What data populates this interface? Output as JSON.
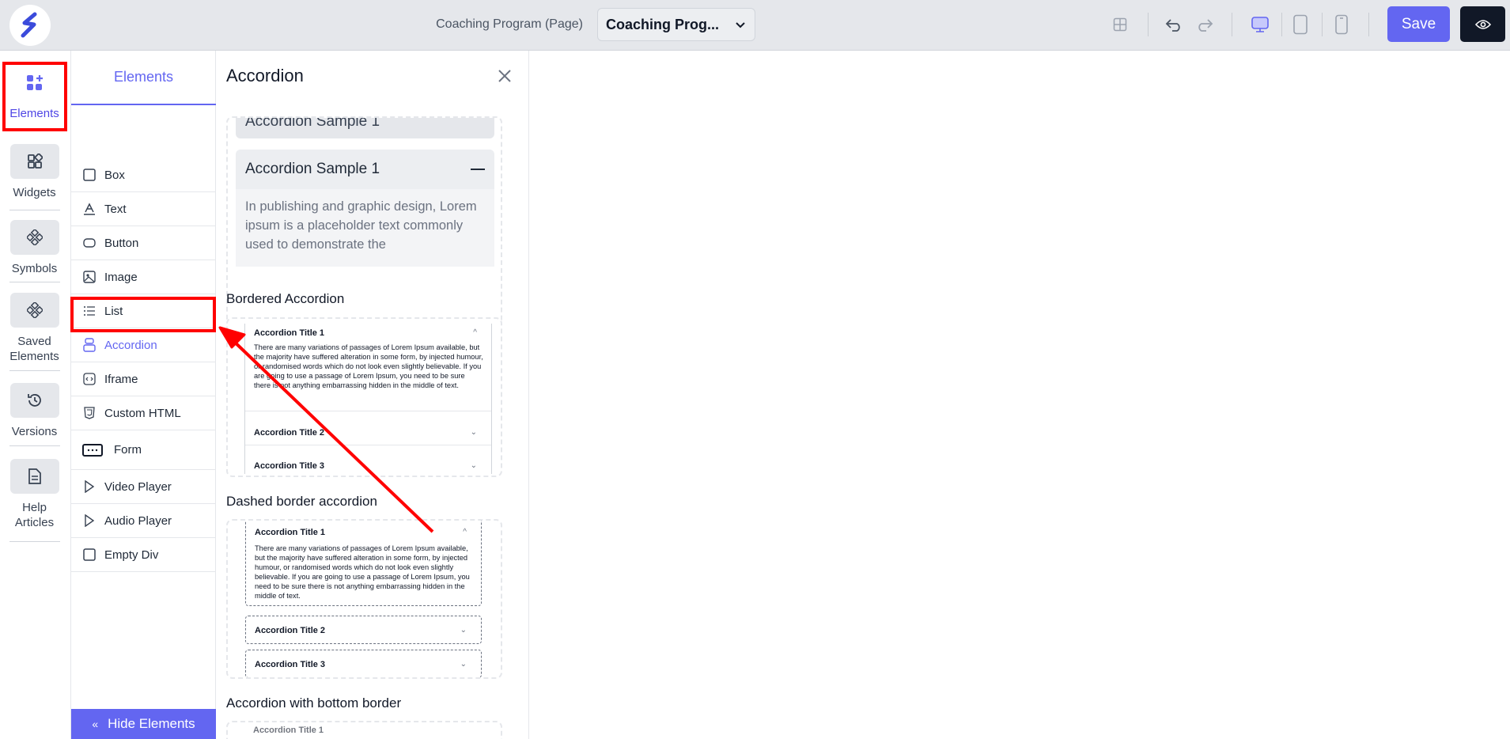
{
  "topbar": {
    "page_label": "Coaching Program (Page)",
    "page_select_value": "Coaching Prog...",
    "save_label": "Save"
  },
  "rail": {
    "items": [
      {
        "label": "Elements",
        "icon": "elements-icon",
        "active": true
      },
      {
        "label": "Widgets",
        "icon": "widgets-icon"
      },
      {
        "label": "Symbols",
        "icon": "symbols-icon"
      },
      {
        "label": "Saved Elements",
        "icon": "saved-elements-icon"
      },
      {
        "label": "Versions",
        "icon": "history-icon"
      },
      {
        "label": "Help Articles",
        "icon": "document-icon"
      }
    ]
  },
  "elements": {
    "tab_label": "Elements",
    "items": [
      {
        "label": "Box",
        "icon": "box-icon"
      },
      {
        "label": "Text",
        "icon": "text-icon"
      },
      {
        "label": "Button",
        "icon": "button-icon"
      },
      {
        "label": "Image",
        "icon": "image-icon"
      },
      {
        "label": "List",
        "icon": "list-icon"
      },
      {
        "label": "Accordion",
        "icon": "accordion-icon",
        "active": true
      },
      {
        "label": "Iframe",
        "icon": "iframe-icon"
      },
      {
        "label": "Custom HTML",
        "icon": "html5-icon"
      },
      {
        "label": "Form",
        "icon": "form-icon"
      },
      {
        "label": "Video Player",
        "icon": "play-icon"
      },
      {
        "label": "Audio Player",
        "icon": "play-icon"
      },
      {
        "label": "Empty Div",
        "icon": "box-icon"
      }
    ],
    "hide_label": "Hide Elements"
  },
  "panel": {
    "title": "Accordion",
    "sample1": {
      "top_title": "Accordion Sample 1",
      "title": "Accordion Sample 1",
      "body": "In publishing and graphic design, Lorem ipsum is a placeholder text commonly used to demonstrate the"
    },
    "bordered": {
      "heading": "Bordered Accordion",
      "title1": "Accordion Title 1",
      "body1": "There are many variations of passages of Lorem Ipsum available, but the majority have suffered alteration in some form, by injected humour, or randomised words which do not look even slightly believable. If you are going to use a passage of Lorem Ipsum, you need to be sure there is not anything embarrassing hidden in the middle of text.",
      "title2": "Accordion Title 2",
      "title3": "Accordion Title 3"
    },
    "dashed": {
      "heading": "Dashed border accordion",
      "title1": "Accordion Title 1",
      "body1": "There are many variations of passages of Lorem Ipsum available, but the majority have suffered alteration in some form, by injected humour, or randomised words which do not look even slightly believable. If you are going to use a passage of Lorem Ipsum, you need to be sure there is not anything embarrassing hidden in the middle of text.",
      "title2": "Accordion Title 2",
      "title3": "Accordion Title 3"
    },
    "bottom_border": {
      "heading": "Accordion with bottom border",
      "title1": "Accordion Title 1"
    }
  },
  "colors": {
    "accent": "#6366f1",
    "annotation": "#ff0000",
    "topbar_bg": "#e5e7eb",
    "preview_button_bg": "#111827"
  }
}
